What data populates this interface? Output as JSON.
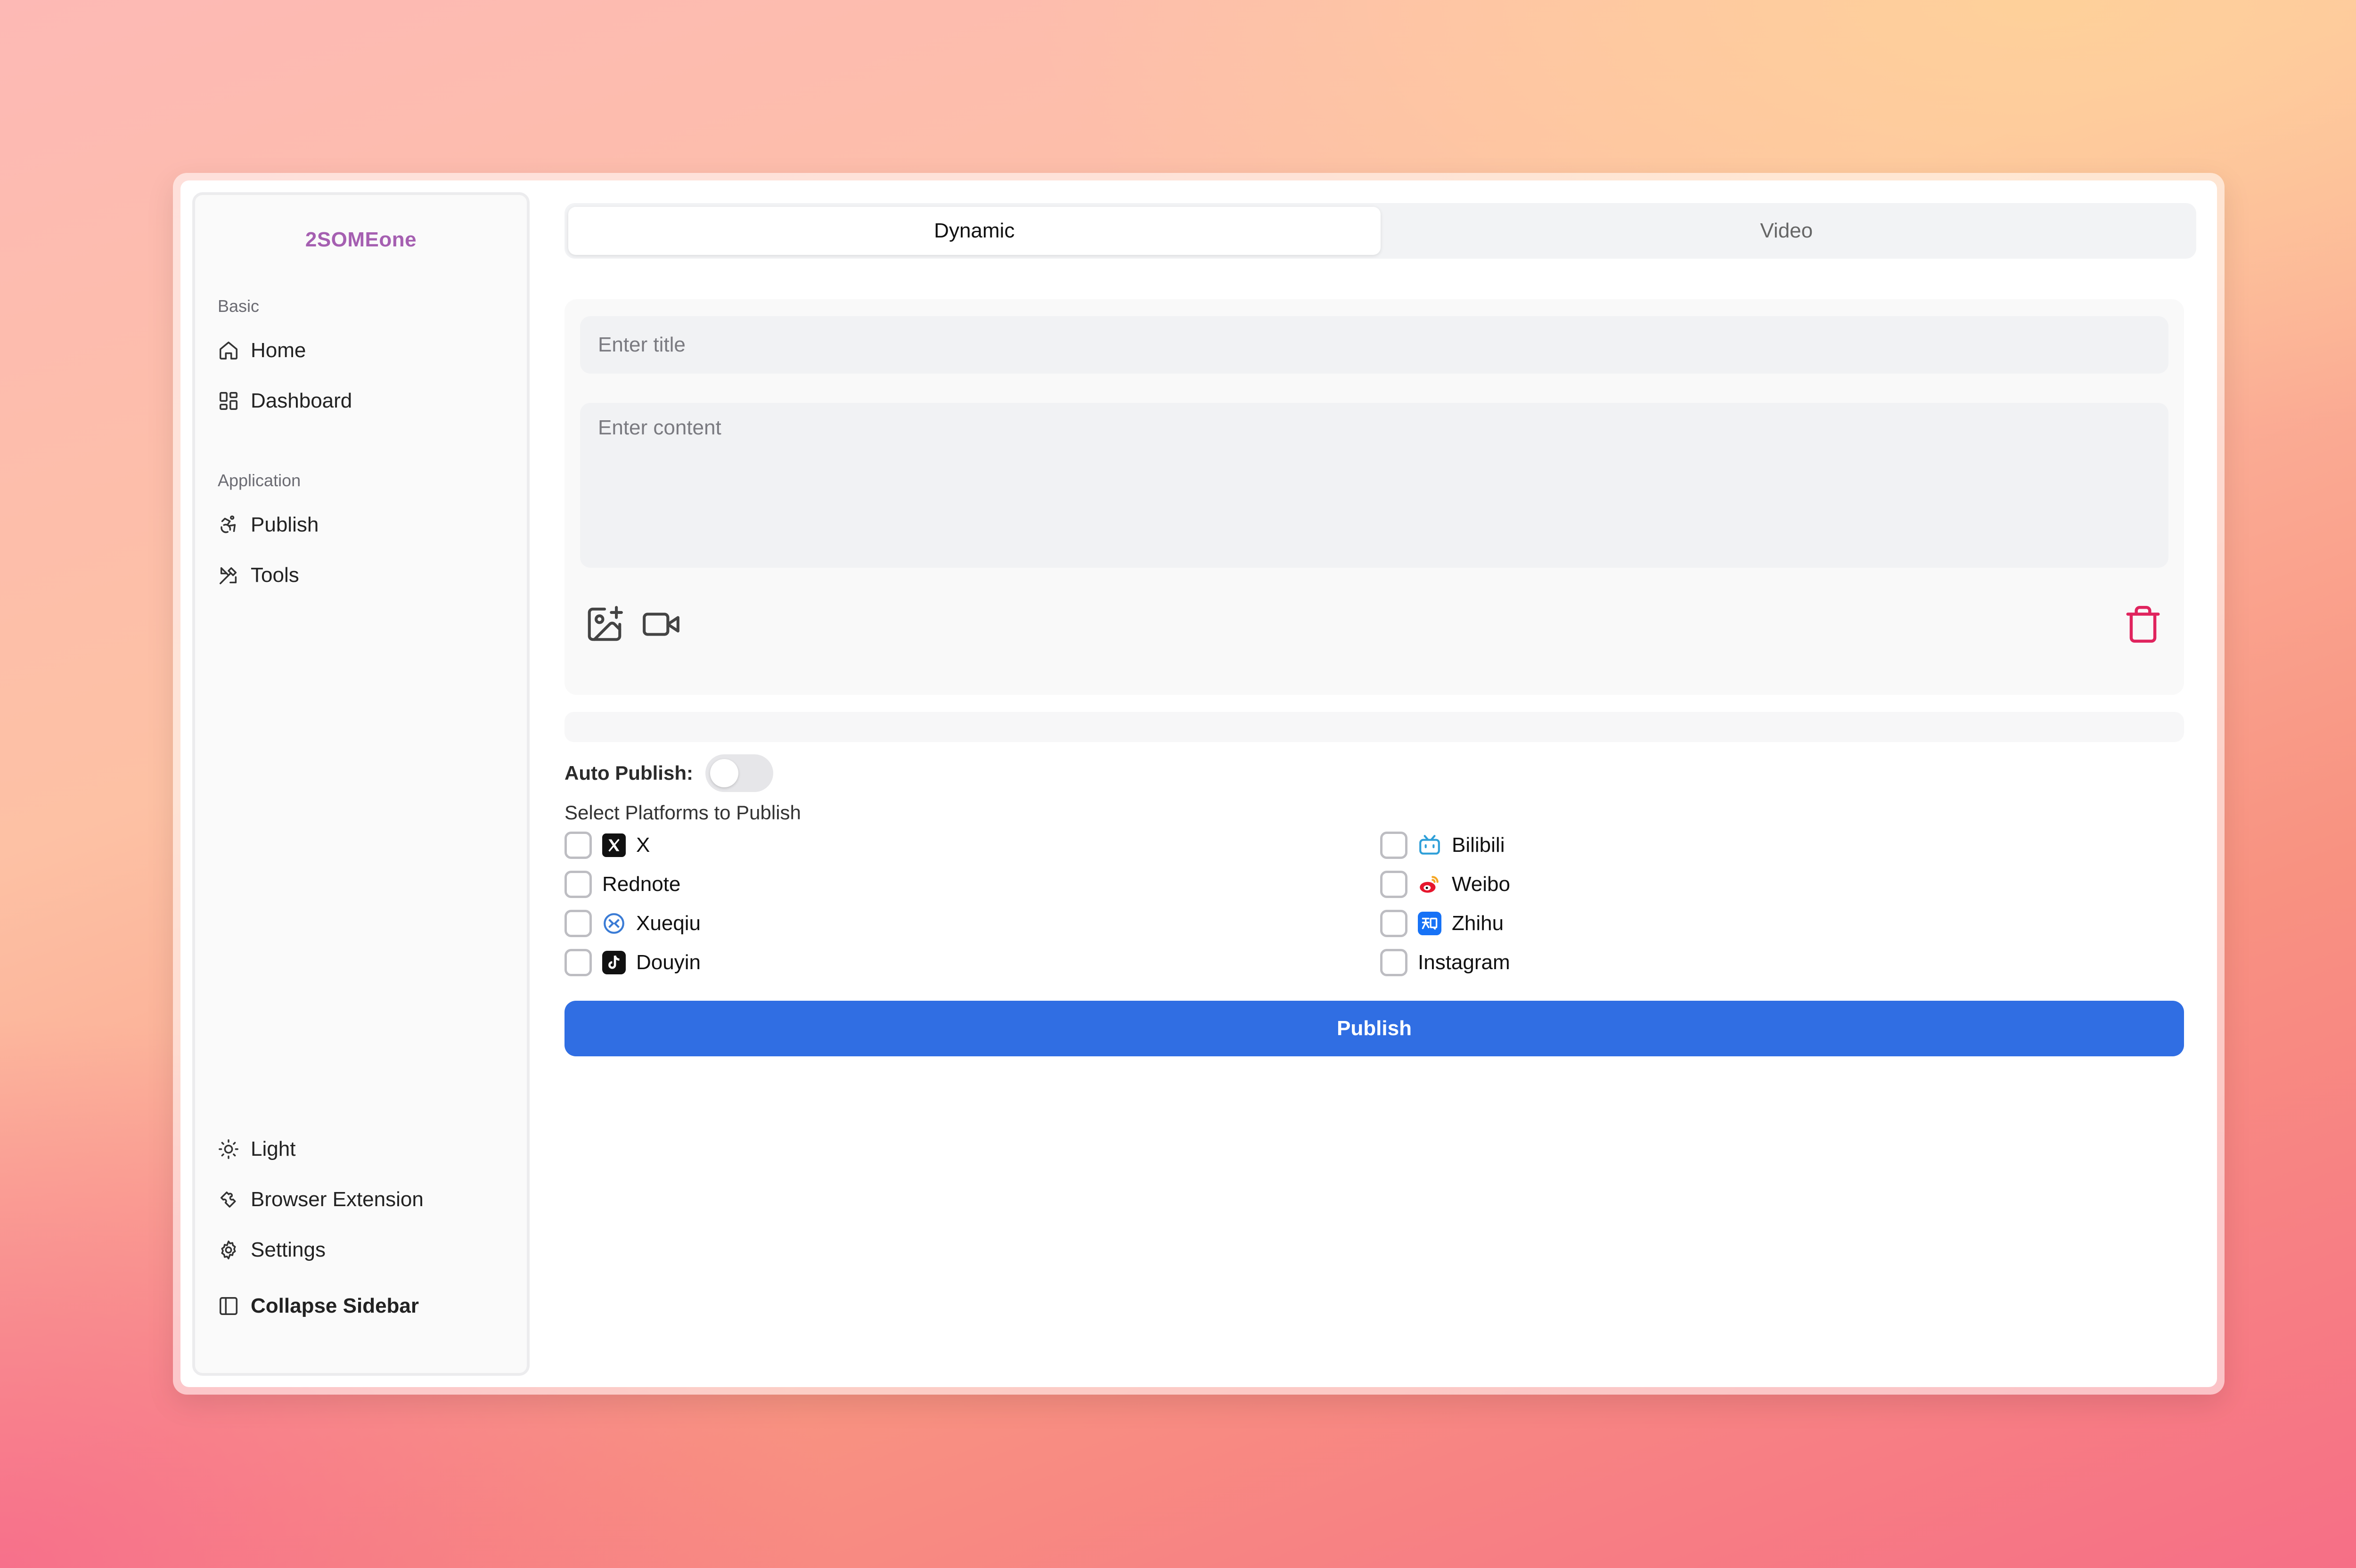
{
  "sidebar": {
    "brand": "2SOMEone",
    "groups": [
      {
        "label": "Basic",
        "items": [
          {
            "label": "Home",
            "icon": "home-icon"
          },
          {
            "label": "Dashboard",
            "icon": "dashboard-icon"
          }
        ]
      },
      {
        "label": "Application",
        "items": [
          {
            "label": "Publish",
            "icon": "publish-icon"
          },
          {
            "label": "Tools",
            "icon": "tools-icon"
          }
        ]
      }
    ],
    "footer": [
      {
        "label": "Light",
        "icon": "sun-icon"
      },
      {
        "label": "Browser Extension",
        "icon": "puzzle-icon"
      },
      {
        "label": "Settings",
        "icon": "gear-icon"
      },
      {
        "label": "Collapse Sidebar",
        "icon": "panel-left-icon"
      }
    ]
  },
  "tabs": [
    {
      "label": "Dynamic",
      "active": true
    },
    {
      "label": "Video",
      "active": false
    }
  ],
  "editor": {
    "title_placeholder": "Enter title",
    "title_value": "",
    "content_placeholder": "Enter content",
    "content_value": ""
  },
  "auto_publish": {
    "label": "Auto Publish:",
    "enabled": false
  },
  "platforms": {
    "label": "Select Platforms to Publish",
    "items": [
      {
        "label": "X",
        "icon": "x-logo-icon",
        "checked": false
      },
      {
        "label": "Bilibili",
        "icon": "bilibili-icon",
        "checked": false
      },
      {
        "label": "Rednote",
        "icon": "",
        "checked": false
      },
      {
        "label": "Weibo",
        "icon": "weibo-icon",
        "checked": false
      },
      {
        "label": "Xueqiu",
        "icon": "xueqiu-icon",
        "checked": false
      },
      {
        "label": "Zhihu",
        "icon": "zhihu-icon",
        "checked": false
      },
      {
        "label": "Douyin",
        "icon": "douyin-icon",
        "checked": false
      },
      {
        "label": "Instagram",
        "icon": "",
        "checked": false
      }
    ]
  },
  "publish_button": {
    "label": "Publish"
  },
  "colors": {
    "brand": "#a55fb1",
    "primary": "#306ee3",
    "danger": "#e0245e"
  }
}
